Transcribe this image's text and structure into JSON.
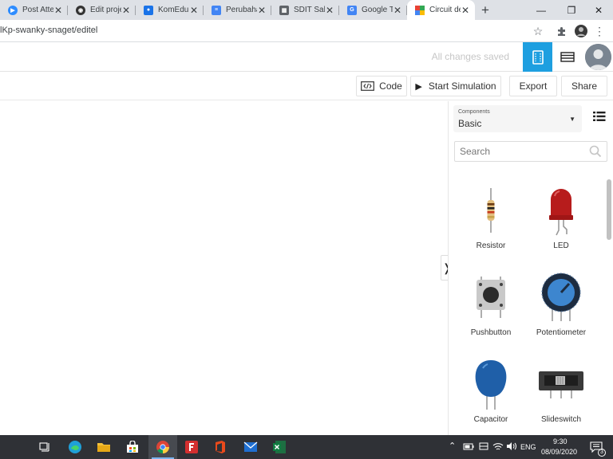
{
  "browser": {
    "tabs": [
      {
        "title": "Post Atte",
        "icon": "zoom-icon",
        "color": "#2d8cff"
      },
      {
        "title": "Edit proje",
        "icon": "instructables-icon",
        "color": "#333333"
      },
      {
        "title": "KomEdu",
        "icon": "contacts-icon",
        "color": "#1a73e8"
      },
      {
        "title": "Perubaha",
        "icon": "docs-icon",
        "color": "#4285f4"
      },
      {
        "title": "SDIT Sab",
        "icon": "classroom-icon",
        "color": "#5f6368"
      },
      {
        "title": "Google T",
        "icon": "translate-icon",
        "color": "#4285f4"
      },
      {
        "title": "Circuit de",
        "icon": "tinkercad-icon",
        "color": "#f4b400"
      }
    ],
    "url": "lKp-swanky-snaget/editel"
  },
  "header": {
    "status": "All changes saved"
  },
  "toolbar": {
    "code": "Code",
    "start_simulation": "Start Simulation",
    "export": "Export",
    "share": "Share"
  },
  "panel": {
    "dropdown_label": "Components",
    "dropdown_value": "Basic",
    "search_placeholder": "Search",
    "components": [
      {
        "name": "Resistor",
        "icon": "resistor-icon"
      },
      {
        "name": "LED",
        "icon": "led-icon"
      },
      {
        "name": "Pushbutton",
        "icon": "pushbutton-icon"
      },
      {
        "name": "Potentiometer",
        "icon": "potentiometer-icon"
      },
      {
        "name": "Capacitor",
        "icon": "capacitor-icon"
      },
      {
        "name": "Slideswitch",
        "icon": "slideswitch-icon"
      }
    ]
  },
  "taskbar": {
    "language": "ENG",
    "time": "9:30",
    "date": "08/09/2020",
    "notifications": "3"
  },
  "colors": {
    "accent": "#1e9fe0",
    "taskbar": "#2f3136"
  }
}
